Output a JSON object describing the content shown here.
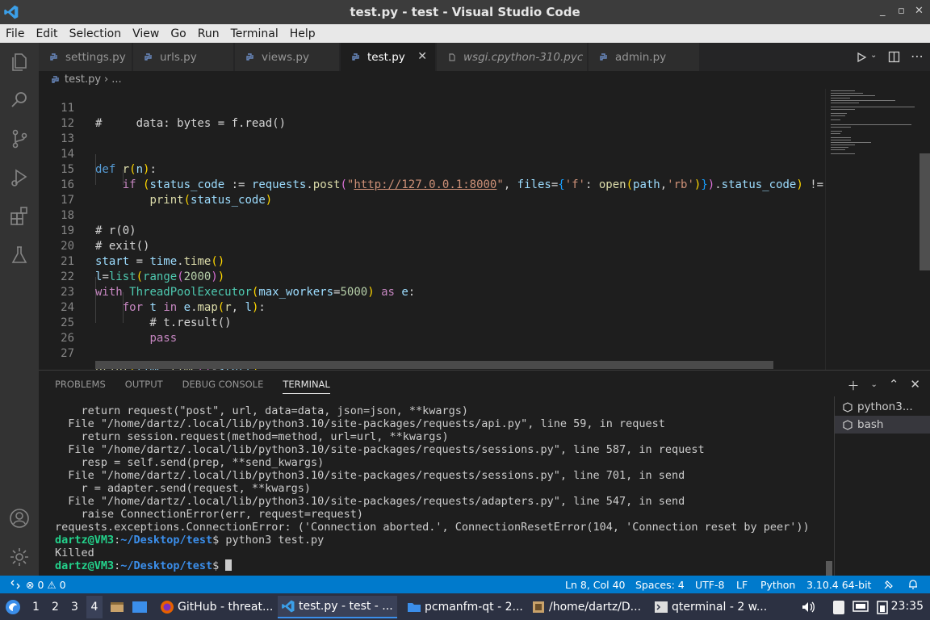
{
  "window": {
    "title": "test.py - test - Visual Studio Code"
  },
  "menu": [
    "File",
    "Edit",
    "Selection",
    "View",
    "Go",
    "Run",
    "Terminal",
    "Help"
  ],
  "tabs": [
    {
      "label": "settings.py",
      "icon": "python-icon",
      "active": false
    },
    {
      "label": "urls.py",
      "icon": "python-icon",
      "active": false
    },
    {
      "label": "views.py",
      "icon": "python-icon",
      "active": false
    },
    {
      "label": "test.py",
      "icon": "python-icon",
      "active": true
    },
    {
      "label": "wsgi.cpython-310.pyc",
      "icon": "file-icon",
      "active": false
    },
    {
      "label": "admin.py",
      "icon": "python-icon",
      "active": false
    }
  ],
  "breadcrumb": {
    "file": "test.py",
    "rest": "..."
  },
  "code": {
    "line_numbers": [
      "11",
      "12",
      "13",
      "14",
      "15",
      "16",
      "17",
      "18",
      "19",
      "20",
      "21",
      "22",
      "23",
      "24",
      "25",
      "26",
      "27"
    ],
    "lines": [
      "#     data: bytes = f.read()",
      "",
      "",
      "def r(n):",
      "    if (status_code := requests.post(\"http://127.0.0.1:8000\", files={'f': open(path,'rb')}).status_code) !=",
      "        print(status_code)",
      "",
      "# r(0)",
      "# exit()",
      "start = time.time()",
      "l=list(range(2000))",
      "with ThreadPoolExecutor(max_workers=5000) as e:",
      "    for t in e.map(r, l):",
      "        # t.result()",
      "        pass",
      "",
      "print(time.time()-start)"
    ]
  },
  "panel": {
    "tabs": [
      "PROBLEMS",
      "OUTPUT",
      "DEBUG CONSOLE",
      "TERMINAL"
    ],
    "active_tab": "TERMINAL",
    "terminal_lines": [
      "    return request(\"post\", url, data=data, json=json, **kwargs)",
      "  File \"/home/dartz/.local/lib/python3.10/site-packages/requests/api.py\", line 59, in request",
      "    return session.request(method=method, url=url, **kwargs)",
      "  File \"/home/dartz/.local/lib/python3.10/site-packages/requests/sessions.py\", line 587, in request",
      "    resp = self.send(prep, **send_kwargs)",
      "  File \"/home/dartz/.local/lib/python3.10/site-packages/requests/sessions.py\", line 701, in send",
      "    r = adapter.send(request, **kwargs)",
      "  File \"/home/dartz/.local/lib/python3.10/site-packages/requests/adapters.py\", line 547, in send",
      "    raise ConnectionError(err, request=request)",
      "requests.exceptions.ConnectionError: ('Connection aborted.', ConnectionResetError(104, 'Connection reset by peer'))"
    ],
    "prompt_user": "dartz@VM3",
    "prompt_sep": ":",
    "prompt_path": "~/Desktop/test",
    "prompt_dollar": "$",
    "command": " python3 test.py",
    "killed": "Killed",
    "terminals": [
      "python3...",
      "bash"
    ],
    "active_terminal": "bash"
  },
  "status": {
    "errors": "0",
    "warnings": "0",
    "position": "Ln 8, Col 40",
    "spaces": "Spaces: 4",
    "encoding": "UTF-8",
    "eol": "LF",
    "language": "Python",
    "interpreter": "3.10.4 64-bit"
  },
  "taskbar": {
    "workspaces": [
      "1",
      "2",
      "3",
      "4"
    ],
    "active_workspace": "4",
    "tasks": [
      {
        "label": "GitHub - threat...",
        "icon": "firefox-icon"
      },
      {
        "label": "test.py - test - ...",
        "icon": "vscode-icon"
      },
      {
        "label": "pcmanfm-qt - 2...",
        "icon": "folder-icon"
      },
      {
        "label": "/home/dartz/D...",
        "icon": "file-manager-icon"
      },
      {
        "label": "qterminal - 2 w...",
        "icon": "terminal-icon"
      }
    ],
    "clock": "23:35"
  },
  "colors": {
    "accent": "#007acc",
    "titlebar": "#3c3c3c",
    "editor_bg": "#1e1e1e",
    "taskbar": "#2c3142"
  }
}
